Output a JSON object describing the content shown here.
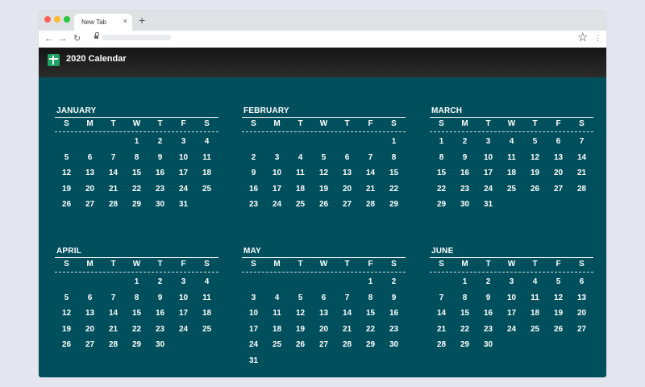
{
  "browser": {
    "tab_title": "New Tab",
    "tab_close": "×",
    "new_tab": "+",
    "star": "☆",
    "menu": "⋮"
  },
  "app": {
    "title": "2020 Calendar"
  },
  "weekdays": [
    "S",
    "M",
    "T",
    "W",
    "T",
    "F",
    "S"
  ],
  "months": [
    {
      "name": "JANUARY",
      "start": 3,
      "days": 31
    },
    {
      "name": "FEBRUARY",
      "start": 6,
      "days": 29
    },
    {
      "name": "MARCH",
      "start": 0,
      "days": 31
    },
    {
      "name": "APRIL",
      "start": 3,
      "days": 30
    },
    {
      "name": "MAY",
      "start": 5,
      "days": 31
    },
    {
      "name": "JUNE",
      "start": 1,
      "days": 30
    }
  ]
}
